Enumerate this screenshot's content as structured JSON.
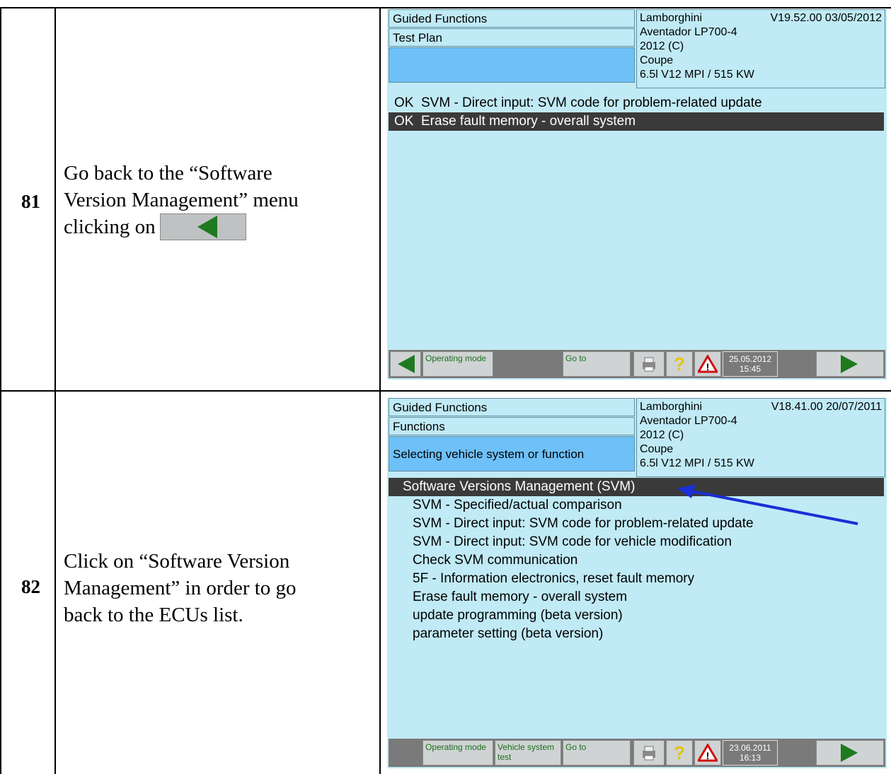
{
  "rows": [
    {
      "number": "81",
      "instruction_lines": [
        "Go back to the “Software",
        "Version Management” menu",
        "clicking on"
      ],
      "screen": {
        "left_panel": [
          "Guided Functions",
          "Test Plan",
          ""
        ],
        "vehicle": {
          "make": "Lamborghini",
          "version": "V19.52.00 03/05/2012",
          "model": "Aventador LP700-4",
          "year": "2012 (C)",
          "body": "Coupe",
          "engine": "6.5l V12 MPI / 515 KW"
        },
        "list_items": [
          {
            "status": "OK",
            "label": "SVM - Direct input: SVM code for problem-related update",
            "selected": false
          },
          {
            "status": "OK",
            "label": "Erase fault memory - overall system",
            "selected": true
          }
        ],
        "toolbar": {
          "operating_mode": "Operating mode",
          "go_to": "Go to",
          "date": "25.05.2012",
          "time": "15:45"
        }
      }
    },
    {
      "number": "82",
      "instruction_lines": [
        "Click on “Software Version",
        "Management” in order to go",
        "back to the ECUs list."
      ],
      "screen": {
        "left_panel": [
          "Guided Functions",
          "Functions",
          "Selecting vehicle system or function"
        ],
        "vehicle": {
          "make": "Lamborghini",
          "version": "V18.41.00 20/07/2011",
          "model": "Aventador LP700-4",
          "year": "2012 (C)",
          "body": "Coupe",
          "engine": "6.5l V12 MPI / 515 KW"
        },
        "list_items": [
          {
            "label": "Software Versions Management (SVM)",
            "selected": true
          },
          {
            "label": "SVM - Specified/actual comparison",
            "selected": false
          },
          {
            "label": "SVM - Direct input: SVM code for problem-related update",
            "selected": false
          },
          {
            "label": "SVM - Direct input: SVM code for vehicle modification",
            "selected": false
          },
          {
            "label": "Check SVM communication",
            "selected": false
          },
          {
            "label": "5F - Information electronics, reset fault memory",
            "selected": false
          },
          {
            "label": "Erase fault memory - overall system",
            "selected": false
          },
          {
            "label": "update programming (beta version)",
            "selected": false
          },
          {
            "label": "parameter setting (beta version)",
            "selected": false
          }
        ],
        "toolbar": {
          "operating_mode": "Operating mode",
          "vehicle_system_test": "Vehicle system test",
          "go_to": "Go to",
          "date": "23.06.2011",
          "time": "16:13"
        }
      }
    }
  ],
  "colors": {
    "screen_bg": "#c0eaf5",
    "selected_bg": "#3a3a3a",
    "panel_blue": "#6ec0f8",
    "nav_arrow": "#1f7a1f",
    "annotation_arrow": "#1a2fd6"
  }
}
